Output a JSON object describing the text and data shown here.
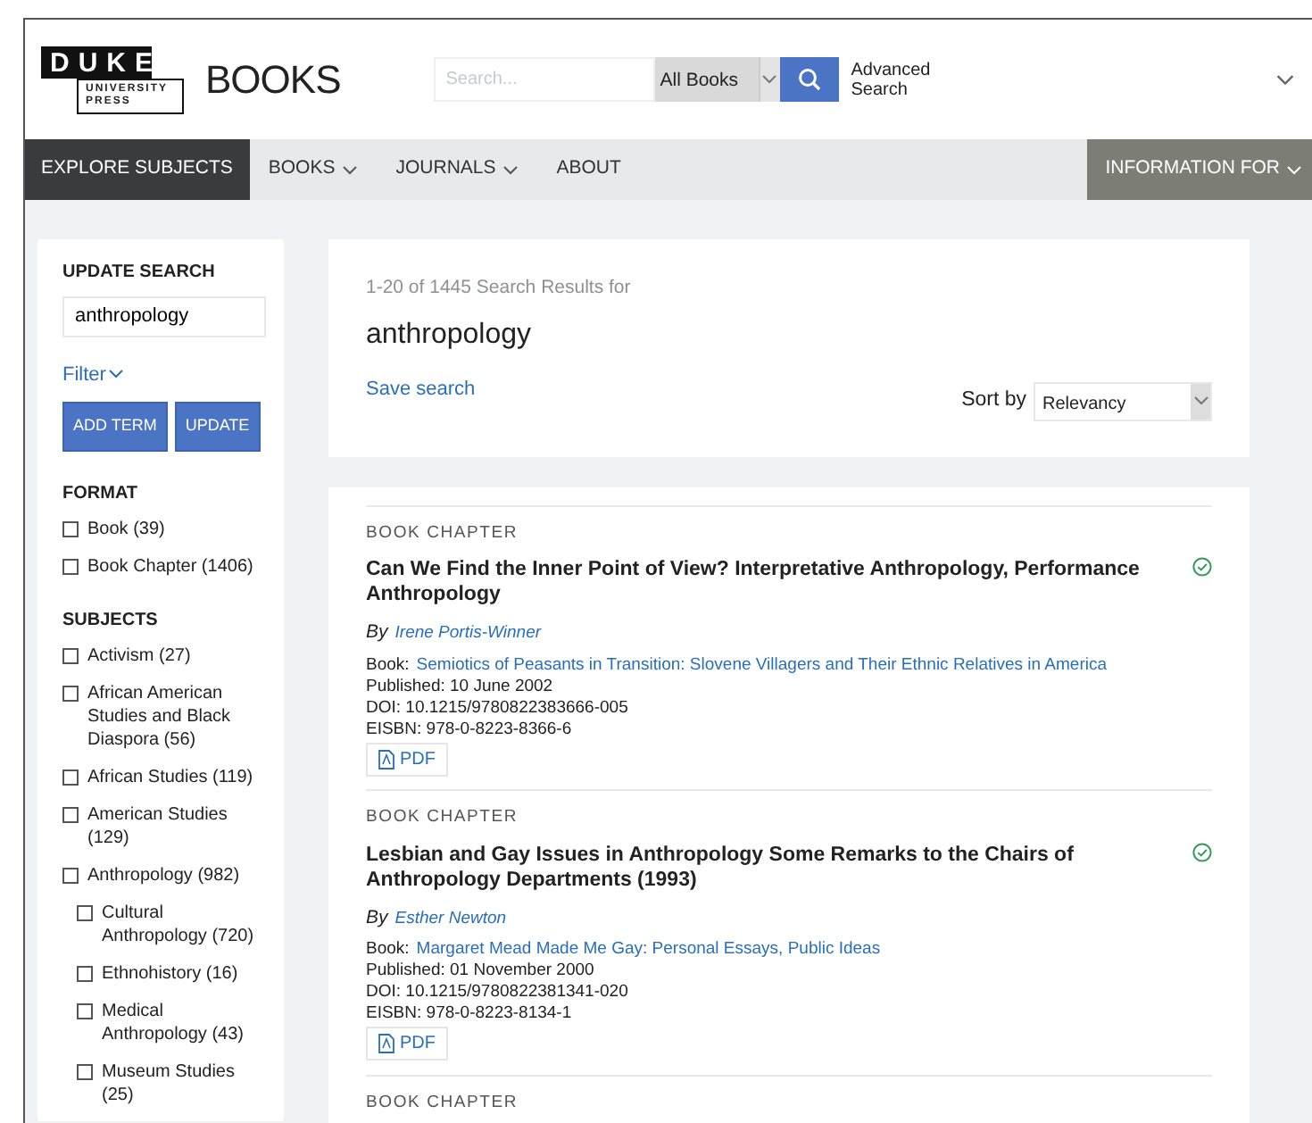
{
  "header": {
    "logo": {
      "top": "DUKE",
      "bottom": [
        "UNIVERSITY",
        "PRESS"
      ]
    },
    "site_title": "BOOKS",
    "search": {
      "placeholder": "Search..."
    },
    "scope": "All Books",
    "advanced": "Advanced Search"
  },
  "nav": {
    "items": [
      {
        "label": "EXPLORE SUBJECTS",
        "dropdown": false,
        "selected": true
      },
      {
        "label": "BOOKS",
        "dropdown": true,
        "selected": false
      },
      {
        "label": "JOURNALS",
        "dropdown": true,
        "selected": false
      },
      {
        "label": "ABOUT",
        "dropdown": false,
        "selected": false
      }
    ],
    "right": {
      "label": "INFORMATION FOR",
      "dropdown": true
    }
  },
  "sidebar": {
    "title": "UPDATE SEARCH",
    "search_value": "anthropology",
    "filter": "Filter",
    "buttons": [
      "ADD TERM",
      "UPDATE"
    ],
    "facets": [
      {
        "title": "FORMAT",
        "options": [
          {
            "label": "Book (39)",
            "checked": false
          },
          {
            "label": "Book Chapter (1406)",
            "checked": false
          }
        ]
      },
      {
        "title": "SUBJECTS",
        "options": [
          {
            "label": "Activism (27)",
            "checked": false
          },
          {
            "label": "African American Studies and Black Diaspora (56)",
            "checked": false
          },
          {
            "label": "African Studies (119)",
            "checked": false
          },
          {
            "label": "American Studies (129)",
            "checked": false
          },
          {
            "label": "Anthropology (982)",
            "checked": false,
            "children": [
              {
                "label": "Cultural Anthropology (720)",
                "checked": false
              },
              {
                "label": "Ethnohistory (16)",
                "checked": false
              },
              {
                "label": "Medical Anthropology (43)",
                "checked": false
              },
              {
                "label": "Museum Studies (25)",
                "checked": false
              }
            ]
          }
        ]
      }
    ]
  },
  "results": {
    "summary": "1-20 of 1445 Search Results for",
    "query": "anthropology",
    "save": "Save search",
    "sort_label": "Sort by",
    "sort_value": "Relevancy",
    "items": [
      {
        "type": "BOOK CHAPTER",
        "title": "Can We Find the Inner Point of View? Interpretative Anthropology, Performance Anthropology",
        "access": true,
        "by": "By",
        "author": "Irene Portis-Winner",
        "book_label": "Book:",
        "book": "Semiotics of Peasants in Transition: Slovene Villagers and Their Ethnic Relatives in America",
        "published": "Published: 10 June 2002",
        "doi": "DOI: 10.1215/9780822383666-005",
        "eisbn": "EISBN: 978-0-8223-8366-6",
        "pdf": "PDF"
      },
      {
        "type": "BOOK CHAPTER",
        "title": "Lesbian and Gay Issues in Anthropology Some Remarks to the Chairs of Anthropology Departments (1993)",
        "access": true,
        "by": "By",
        "author": "Esther Newton",
        "book_label": "Book:",
        "book": "Margaret Mead Made Me Gay: Personal Essays, Public Ideas",
        "published": "Published: 01 November 2000",
        "doi": "DOI: 10.1215/9780822381341-020",
        "eisbn": "EISBN: 978-0-8223-8134-1",
        "pdf": "PDF"
      },
      {
        "type": "BOOK CHAPTER"
      }
    ]
  }
}
